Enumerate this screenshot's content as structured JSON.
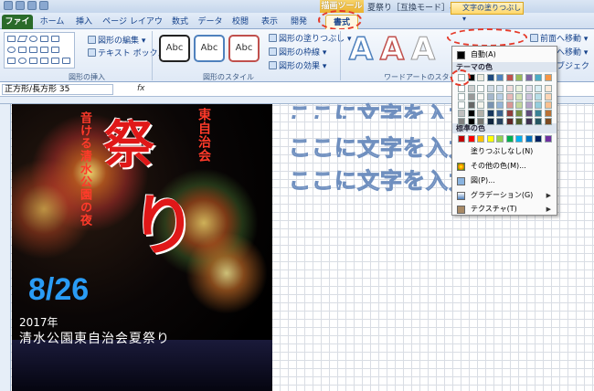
{
  "window": {
    "title": "夏祭り［互換モード］- Microsoft Excel",
    "contextual_tab_group": "描画ツール"
  },
  "tabs": [
    "ファイル",
    "ホーム",
    "挿入",
    "ページ レイアウト",
    "数式",
    "データ",
    "校閲",
    "表示",
    "開発",
    "書式"
  ],
  "ribbon": {
    "shapes_group": {
      "edit_shape": "図形の編集 ▾",
      "text_box": "テキスト ボックス ▾",
      "caption": "図形の挿入"
    },
    "shape_styles": {
      "abc": "Abc",
      "fill": "図形の塗りつぶし ▾",
      "outline": "図形の枠線 ▾",
      "effects": "図形の効果 ▾",
      "caption": "図形のスタイル"
    },
    "wordart": {
      "letter": "A",
      "text_fill": "文字の塗りつぶし ▾",
      "caption": "ワードアートのスタイル"
    },
    "arrange": {
      "bring_forward": "前面へ移動 ▾",
      "send_backward": "背面へ移動 ▾",
      "selection_pane": "オブジェクトの選択と..."
    }
  },
  "formula_bar": {
    "name_box": "正方形/長方形 35",
    "fx": "fx"
  },
  "poster": {
    "main_char_1": "祭",
    "main_char_2": "り",
    "vertical_1": "東自治会",
    "vertical_2": "音ける清水公園の夜",
    "date": "8/26",
    "year": "2017年",
    "event": "清水公園東自治会夏祭り"
  },
  "ghost_text": [
    "ここに文字を入力",
    "ここに文字を入力",
    "ここに文字を入力"
  ],
  "dropdown": {
    "auto": "自動(A)",
    "theme_colors": "テーマの色",
    "standard_colors": "標準の色",
    "no_fill": "塗りつぶしなし(N)",
    "more_colors": "その他の色(M)...",
    "picture": "図(P)...",
    "gradient": "グラデーション(G)",
    "texture": "テクスチャ(T)",
    "theme_swatches": [
      "#ffffff",
      "#000000",
      "#eeece1",
      "#1f497d",
      "#4f81bd",
      "#c0504d",
      "#9bbb59",
      "#8064a2",
      "#4bacc6",
      "#f79646"
    ],
    "standard_swatches": [
      "#c00000",
      "#ff0000",
      "#ffc000",
      "#ffff00",
      "#92d050",
      "#00b050",
      "#00b0f0",
      "#0070c0",
      "#002060",
      "#7030a0"
    ]
  },
  "colors": {
    "accent_red": "#e53a2a",
    "ribbon_blue": "#15428b",
    "file_tab": "#2a6b2a"
  }
}
